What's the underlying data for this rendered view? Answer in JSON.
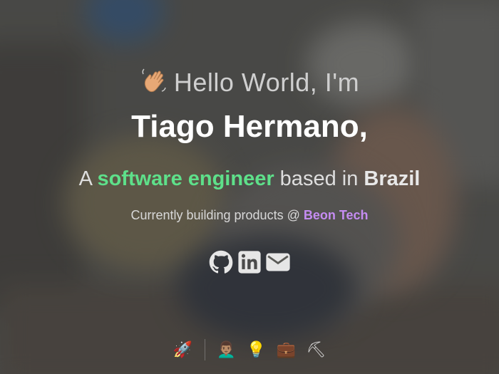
{
  "hero": {
    "greeting": "Hello World, I'm",
    "name": "Tiago Hermano,",
    "role_prefix": "A ",
    "role_highlight": "software engineer",
    "role_middle": " based in ",
    "role_country": "Brazil",
    "current_prefix": "Currently building products @ ",
    "current_company": "Beon Tech"
  },
  "colors": {
    "highlight_green": "#5ee08a",
    "company_purple": "#c58cf2",
    "name_white": "#ffffff"
  },
  "socials": [
    {
      "name": "github-icon"
    },
    {
      "name": "linkedin-icon"
    },
    {
      "name": "mail-icon"
    }
  ],
  "dock": [
    {
      "name": "rocket-icon",
      "glyph": "🚀"
    },
    {
      "name": "avatar-icon",
      "glyph": "👨🏽‍🦱"
    },
    {
      "name": "lightbulb-icon",
      "glyph": "💡"
    },
    {
      "name": "briefcase-icon",
      "glyph": "💼"
    },
    {
      "name": "hammer-icon",
      "glyph": "⛏"
    }
  ]
}
